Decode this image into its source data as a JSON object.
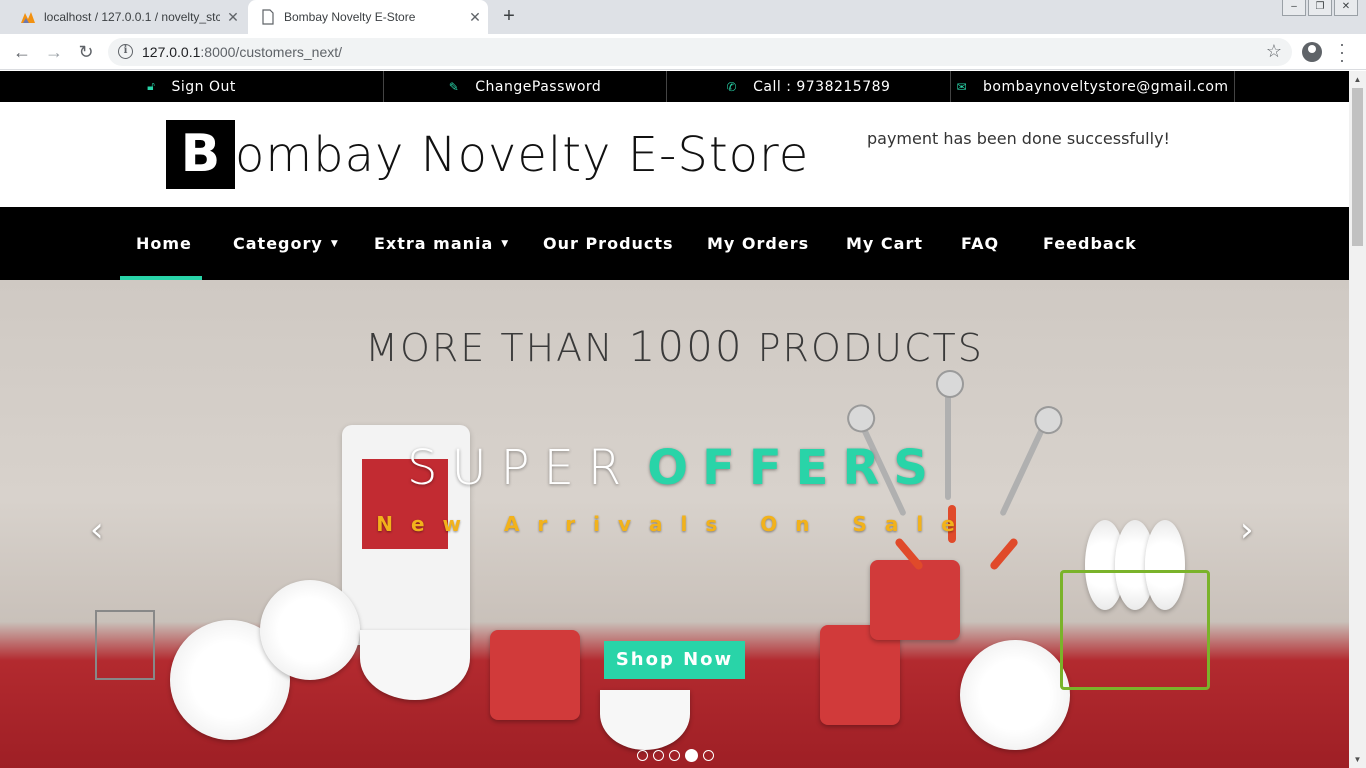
{
  "browser": {
    "tabs": [
      {
        "title": "localhost / 127.0.0.1 / novelty_stc",
        "active": false
      },
      {
        "title": "Bombay Novelty E-Store",
        "active": true
      }
    ],
    "url_host": "127.0.0.1",
    "url_path": ":8000/customers_next/"
  },
  "topbar": {
    "sign_out": "Sign Out",
    "change_password": "ChangePassword",
    "call": "Call : 9738215789",
    "email": "bombaynoveltystore@gmail.com"
  },
  "header": {
    "logo_initial": "B",
    "logo_rest": "ombay Novelty E-Store",
    "message": "payment has been done successfully!"
  },
  "nav": {
    "items": [
      {
        "label": "Home",
        "active": true,
        "dropdown": false
      },
      {
        "label": "Category",
        "active": false,
        "dropdown": true
      },
      {
        "label": "Extra mania",
        "active": false,
        "dropdown": true
      },
      {
        "label": "Our Products",
        "active": false,
        "dropdown": false
      },
      {
        "label": "My Orders",
        "active": false,
        "dropdown": false
      },
      {
        "label": "My Cart",
        "active": false,
        "dropdown": false
      },
      {
        "label": "FAQ",
        "active": false,
        "dropdown": false
      },
      {
        "label": "Feedback",
        "active": false,
        "dropdown": false
      }
    ]
  },
  "hero": {
    "banner_part1": "MORE THAN ",
    "banner_number": "1000",
    "banner_part2": " PRODUCTS",
    "title_word1": "SUPER",
    "title_word2": "OFFERS",
    "subtitle": "New Arrivals On Sale",
    "button": "Shop Now",
    "slide_count": 5,
    "active_slide": 4
  },
  "colors": {
    "accent": "#29d4a8",
    "subtitle": "#f2b21b",
    "bar": "#000000"
  }
}
